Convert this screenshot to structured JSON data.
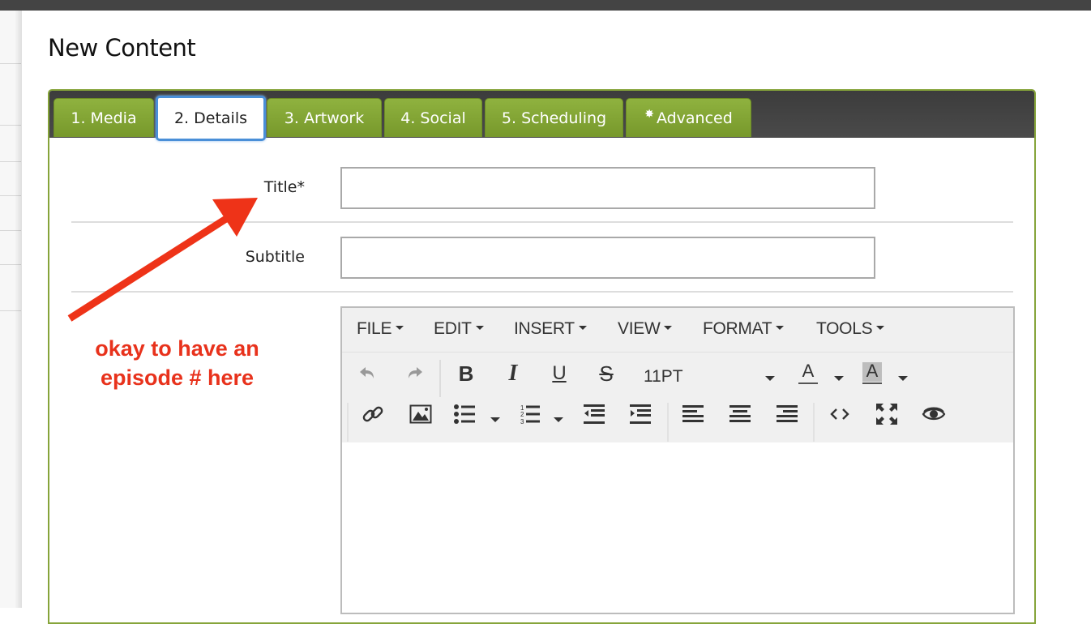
{
  "page": {
    "title": "New Content"
  },
  "tabs": [
    {
      "label": "1. Media",
      "active": false
    },
    {
      "label": "2. Details",
      "active": true
    },
    {
      "label": "3. Artwork",
      "active": false
    },
    {
      "label": "4. Social",
      "active": false
    },
    {
      "label": "5. Scheduling",
      "active": false
    },
    {
      "label": "Advanced",
      "active": false,
      "icon": "gear-icon"
    }
  ],
  "form": {
    "title_label": "Title*",
    "title_value": "",
    "subtitle_label": "Subtitle",
    "subtitle_value": ""
  },
  "editor": {
    "menus": [
      "FILE",
      "EDIT",
      "INSERT",
      "VIEW",
      "FORMAT",
      "TOOLS"
    ],
    "font_size": "11PT",
    "toolbar_icons": [
      "undo-icon",
      "redo-icon",
      "bold-icon",
      "italic-icon",
      "underline-icon",
      "strikethrough-icon",
      "font-size-select",
      "text-color-icon",
      "background-color-icon",
      "link-icon",
      "image-icon",
      "bullet-list-icon",
      "numbered-list-icon",
      "outdent-icon",
      "indent-icon",
      "align-left-icon",
      "align-center-icon",
      "align-right-icon",
      "source-code-icon",
      "fullscreen-icon",
      "preview-icon"
    ],
    "content": ""
  },
  "annotation": {
    "line1": "okay to have an",
    "line2": "episode # here",
    "color": "#e8321c"
  },
  "colors": {
    "tab_green": "#86a43a",
    "tab_bar_dark": "#444444",
    "active_tab_border": "#4a8fd8"
  }
}
